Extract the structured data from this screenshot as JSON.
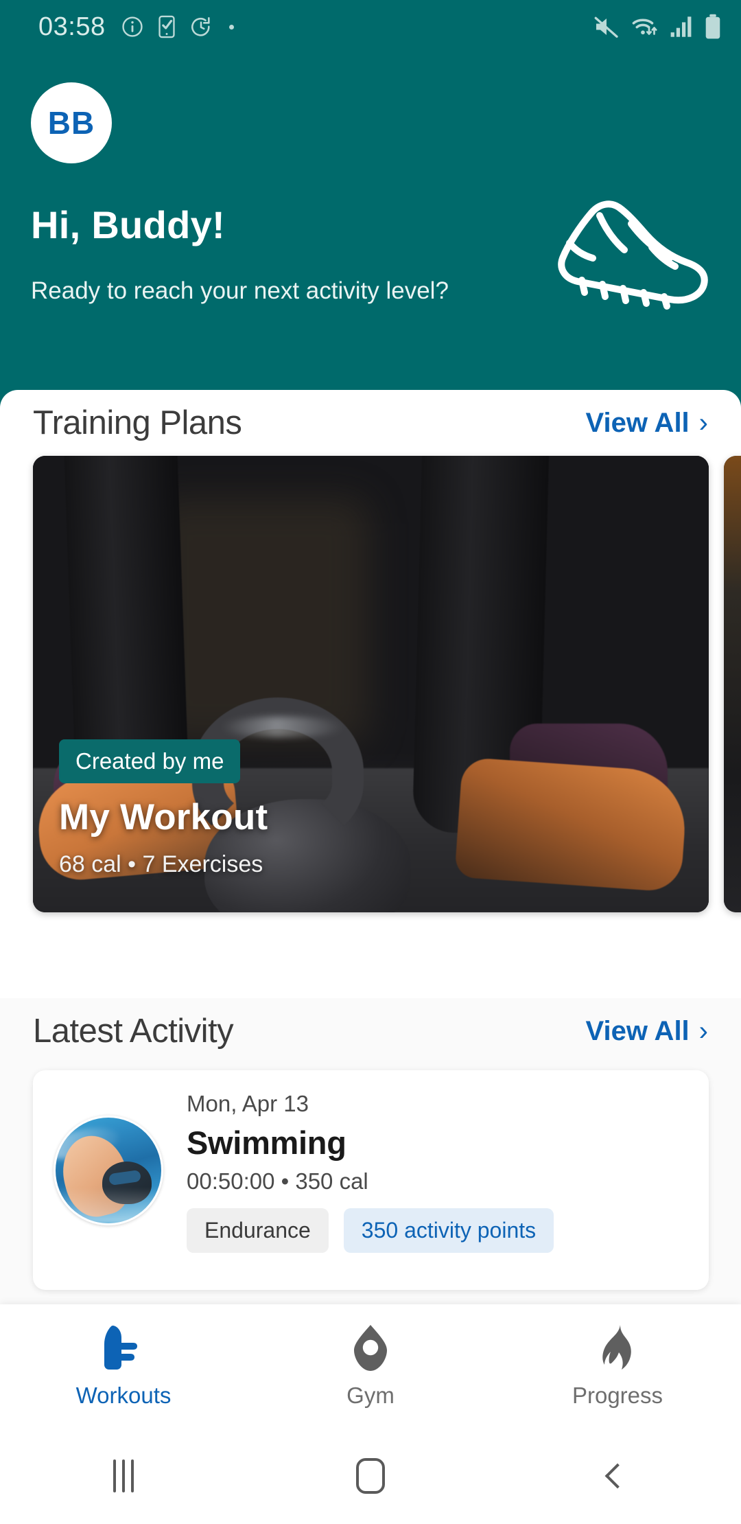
{
  "status_bar": {
    "time": "03:58",
    "left_icons": [
      "info-circle-icon",
      "phone-check-icon",
      "timer-reset-icon",
      "status-dot"
    ],
    "right_icons": [
      "mute-icon",
      "wifi-icon",
      "signal-bars-icon",
      "battery-full-icon"
    ]
  },
  "header": {
    "background_color": "#006A6B",
    "avatar_initials": "BB",
    "avatar_text_color": "#0D63B5",
    "greeting": "Hi, Buddy!",
    "subtitle": "Ready to reach your next activity level?",
    "decor_icon": "running-shoe-icon"
  },
  "training_plans": {
    "title": "Training Plans",
    "view_all_label": "View All",
    "chevron": "›",
    "accent_color": "#0D63B5",
    "cards": [
      {
        "badge": "Created by me",
        "badge_color": "#0A6B6B",
        "title": "My Workout",
        "meta": "68 cal • 7 Exercises",
        "image": "kettlebell-gym-photo"
      },
      {
        "badge": "",
        "title": "",
        "meta": "",
        "image": "dark-gym-photo"
      }
    ]
  },
  "latest_activity": {
    "title": "Latest Activity",
    "view_all_label": "View All",
    "chevron": "›",
    "items": [
      {
        "date": "Mon, Apr 13",
        "name": "Swimming",
        "meta": "00:50:00 • 350 cal",
        "thumbnail": "swimmer-photo",
        "chips": [
          {
            "label": "Endurance",
            "style": "gray"
          },
          {
            "label": "350 activity points",
            "style": "blue"
          }
        ]
      }
    ]
  },
  "bottom_nav": {
    "active_color": "#0D63B5",
    "inactive_color": "#6e6e6e",
    "items": [
      {
        "label": "Workouts",
        "icon": "shoe-icon",
        "active": true
      },
      {
        "label": "Gym",
        "icon": "kettlebell-marker-icon",
        "active": false
      },
      {
        "label": "Progress",
        "icon": "flame-icon",
        "active": false
      }
    ]
  },
  "system_nav": {
    "items": [
      {
        "icon": "recents-icon"
      },
      {
        "icon": "home-icon"
      },
      {
        "icon": "back-icon"
      }
    ]
  }
}
